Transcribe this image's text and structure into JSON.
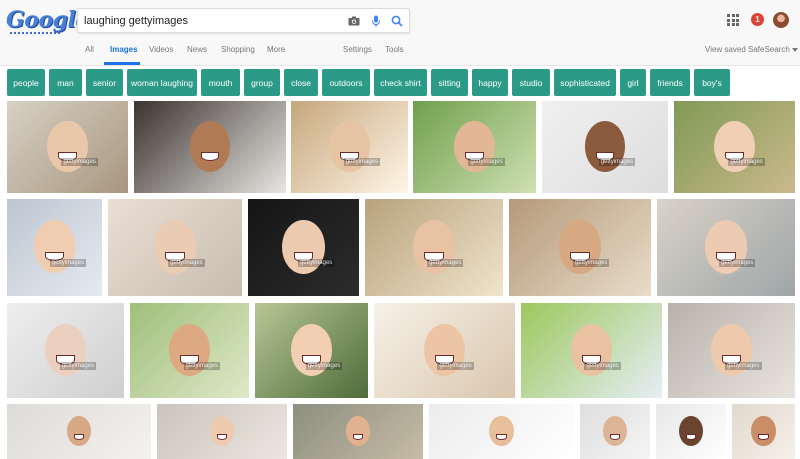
{
  "logo_text": "Google",
  "search": {
    "query": "laughing gettyimages"
  },
  "notifications": {
    "count": "1"
  },
  "tabs": [
    {
      "label": "All",
      "active": false
    },
    {
      "label": "Images",
      "active": true
    },
    {
      "label": "Videos",
      "active": false
    },
    {
      "label": "News",
      "active": false
    },
    {
      "label": "Shopping",
      "active": false
    },
    {
      "label": "More",
      "active": false
    }
  ],
  "tools": {
    "settings": "Settings",
    "tools": "Tools"
  },
  "right_links": {
    "view_saved": "View saved",
    "safesearch": "SafeSearch"
  },
  "chips": [
    "people",
    "man",
    "senior",
    "woman laughing",
    "mouth",
    "group",
    "close",
    "outdoors",
    "check shirt",
    "sitting",
    "happy",
    "studio",
    "sophisticated",
    "girl",
    "friends",
    "boy's"
  ],
  "watermark": "gettyimages",
  "colors": {
    "accent": "#1a73e8",
    "chip": "#2b9b87",
    "notification": "#db4437"
  },
  "icons": [
    "camera-icon",
    "microphone-icon",
    "search-icon",
    "apps-grid-icon"
  ]
}
